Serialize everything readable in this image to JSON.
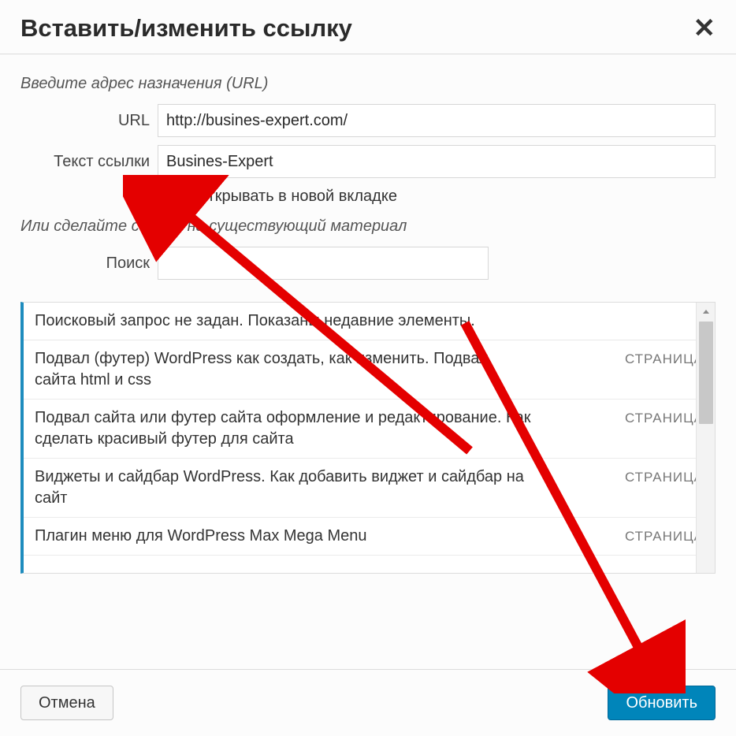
{
  "header": {
    "title": "Вставить/изменить ссылку"
  },
  "body": {
    "instruction_top": "Введите адрес назначения (URL)",
    "url_label": "URL",
    "url_value": "http://busines-expert.com/",
    "linktext_label": "Текст ссылки",
    "linktext_value": "Busines-Expert",
    "newtab_checked": true,
    "newtab_label": "Открывать в новой вкладке",
    "instruction_mid": "Или сделайте ссылку на существующий материал",
    "search_label": "Поиск",
    "search_value": ""
  },
  "list": {
    "status": "Поисковый запрос не задан. Показаны недавние элементы.",
    "items": [
      {
        "title": "Подвал (футер) WordPress как создать, как изменить. Подвал сайта html и css",
        "type": "СТРАНИЦА"
      },
      {
        "title": "Подвал сайта или футер сайта оформление и редактирование. Как сделать красивый футер для сайта",
        "type": "СТРАНИЦА"
      },
      {
        "title": "Виджеты и сайдбар WordPress. Как добавить виджет и сайдбар на сайт",
        "type": "СТРАНИЦА"
      },
      {
        "title": "Плагин меню для WordPress Max Mega Menu",
        "type": "СТРАНИЦА"
      }
    ]
  },
  "footer": {
    "cancel_label": "Отмена",
    "submit_label": "Обновить"
  }
}
